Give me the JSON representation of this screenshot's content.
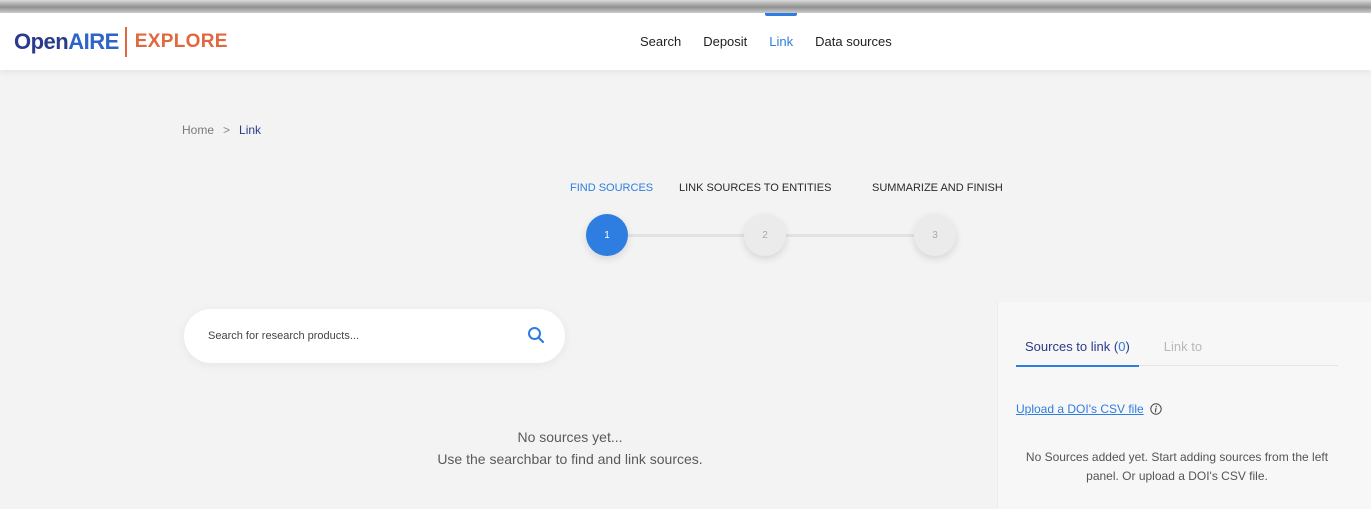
{
  "logo": {
    "open": "Open",
    "aire": "AIRE",
    "explore": "EXPLORE"
  },
  "nav": {
    "items": [
      {
        "label": "Search"
      },
      {
        "label": "Deposit"
      },
      {
        "label": "Link",
        "active": true
      },
      {
        "label": "Data sources"
      }
    ]
  },
  "breadcrumb": {
    "home": "Home",
    "separator": ">",
    "current": "Link"
  },
  "stepper": {
    "steps": [
      {
        "label": "FIND SOURCES",
        "number": "1",
        "active": true
      },
      {
        "label": "LINK SOURCES TO ENTITIES",
        "number": "2",
        "active": false
      },
      {
        "label": "SUMMARIZE AND FINISH",
        "number": "3",
        "active": false
      }
    ]
  },
  "search": {
    "placeholder": "Search for research products...",
    "icon": "search-icon"
  },
  "empty_state": {
    "line1": "No sources yet...",
    "line2": "Use the searchbar to find and link sources."
  },
  "panel": {
    "tabs": {
      "sources_label": "Sources to link (",
      "sources_count": "0",
      "sources_close": ")",
      "link_to": "Link to"
    },
    "upload_link": "Upload a DOI's CSV file",
    "message": "No Sources added yet. Start adding sources from the left panel. Or upload a DOI's CSV file."
  },
  "colors": {
    "accent": "#2e7de0",
    "brand_dark": "#2b3b8c",
    "brand_orange": "#e0683e",
    "background": "#f3f3f3"
  }
}
